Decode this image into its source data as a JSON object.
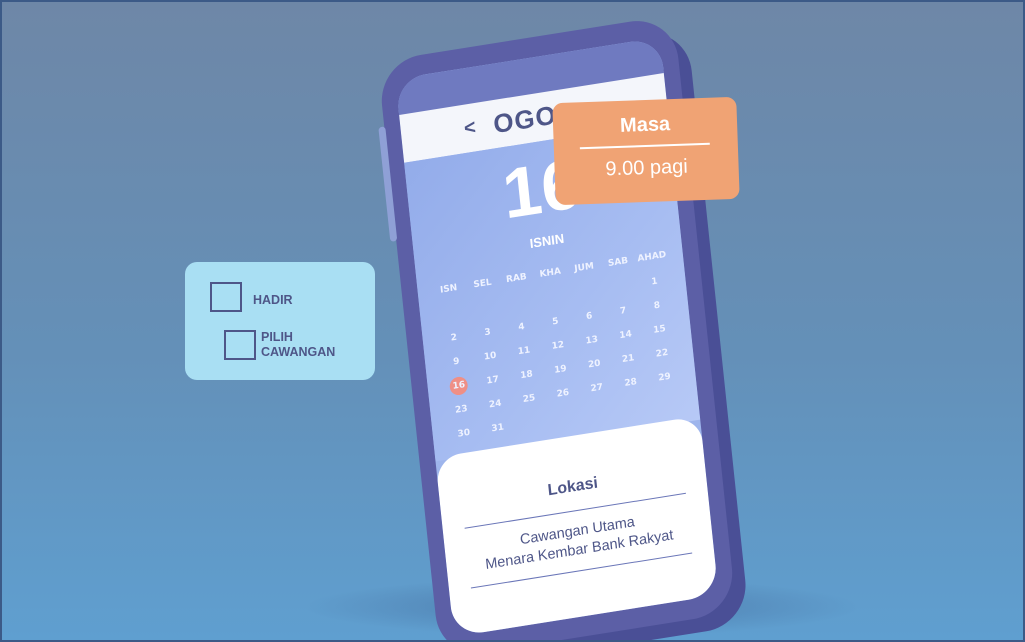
{
  "calendar": {
    "month": "OGOS",
    "prev_arrow": "<",
    "next_arrow": ">",
    "selected_day": "16",
    "selected_day_name": "ISNIN",
    "weekdays": [
      "ISN",
      "SEL",
      "RAB",
      "KHA",
      "JUM",
      "SAB",
      "AHAD"
    ],
    "days": [
      "",
      "",
      "",
      "",
      "",
      "",
      "1",
      "2",
      "3",
      "4",
      "5",
      "6",
      "7",
      "8",
      "9",
      "10",
      "11",
      "12",
      "13",
      "14",
      "15",
      "16",
      "17",
      "18",
      "19",
      "20",
      "21",
      "22",
      "23",
      "24",
      "25",
      "26",
      "27",
      "28",
      "29",
      "30",
      "31",
      "",
      "",
      "",
      "",
      ""
    ],
    "highlight_color": "#ef8f86"
  },
  "time_card": {
    "title": "Masa",
    "value": "9.00 pagi",
    "color": "#f0a374"
  },
  "attendance": {
    "option_1": "HADIR",
    "option_2_line1": "PILIH",
    "option_2_line2": "CAWANGAN",
    "color": "#a9dff3"
  },
  "location": {
    "title": "Lokasi",
    "line1": "Cawangan Utama",
    "line2": "Menara Kembar Bank Rakyat"
  }
}
